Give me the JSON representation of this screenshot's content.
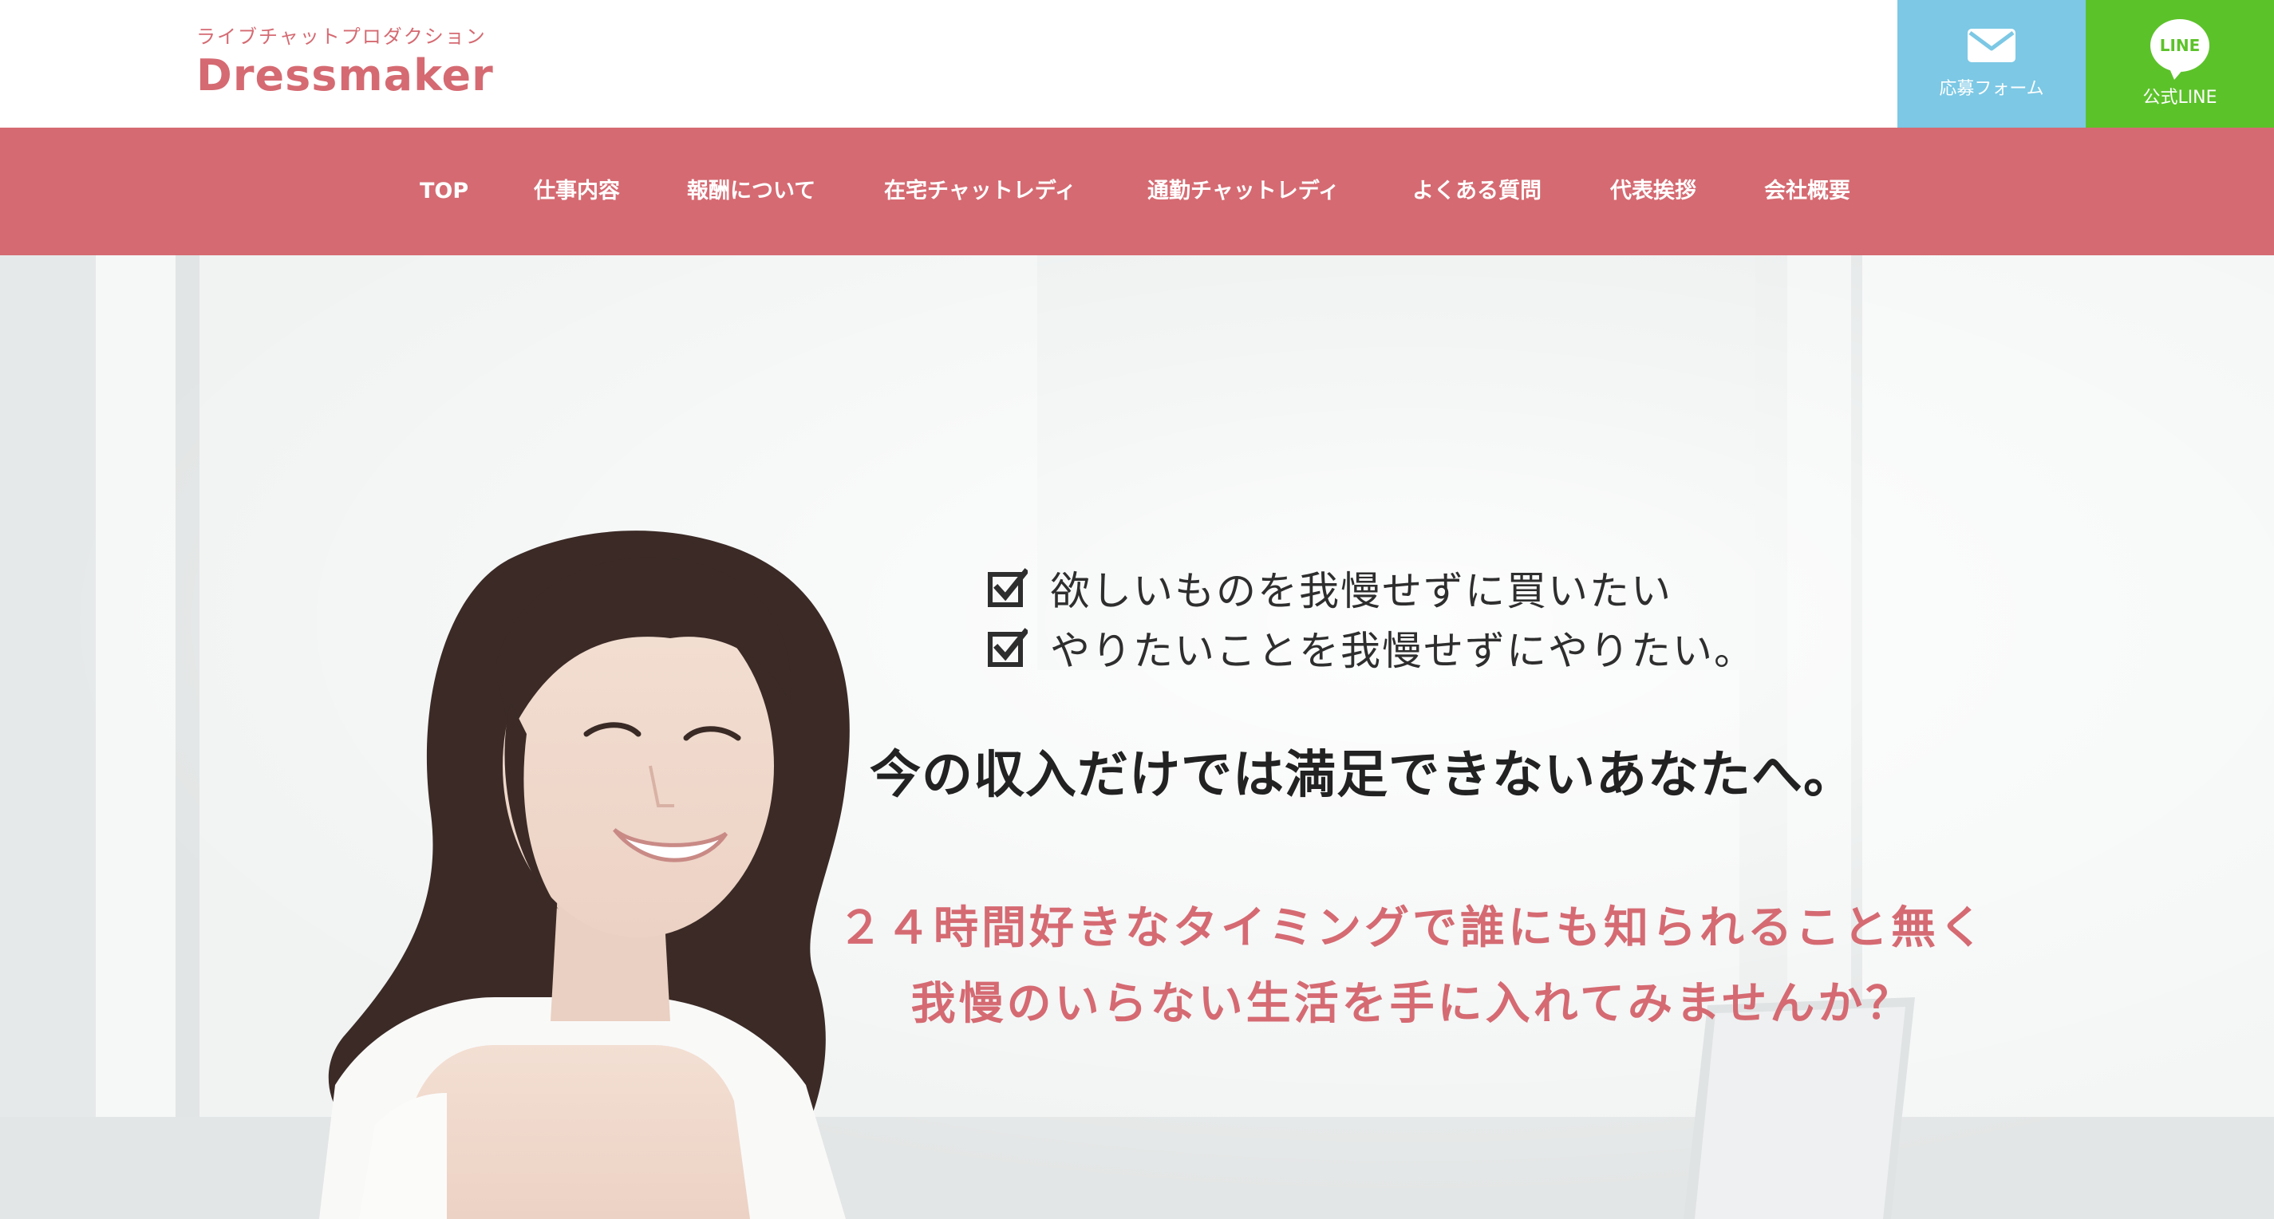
{
  "brand": {
    "tagline": "ライブチャットプロダクション",
    "name": "Dressmaker",
    "accent_color": "#d56a72"
  },
  "header_actions": {
    "apply": {
      "label": "応募フォーム",
      "icon": "mail-icon",
      "color": "#7cc8e5"
    },
    "line": {
      "label": "公式LINE",
      "icon": "line-icon",
      "icon_text": "LINE",
      "color": "#5cc22a"
    }
  },
  "nav": {
    "items": [
      {
        "label": "TOP"
      },
      {
        "label": "仕事内容"
      },
      {
        "label": "報酬について"
      },
      {
        "label": "在宅チャットレディ"
      },
      {
        "label": "通勤チャットレディ"
      },
      {
        "label": "よくある質問"
      },
      {
        "label": "代表挨拶"
      },
      {
        "label": "会社概要"
      }
    ]
  },
  "hero": {
    "checklist": [
      "欲しいものを我慢せずに買いたい",
      "やりたいことを我慢せずにやりたい。"
    ],
    "headline": "今の収入だけでは満足できないあなたへ。",
    "subcopy": [
      "２４時間好きなタイミングで誰にも知られること無く",
      "我慢のいらない生活を手に入れてみませんか？"
    ]
  }
}
